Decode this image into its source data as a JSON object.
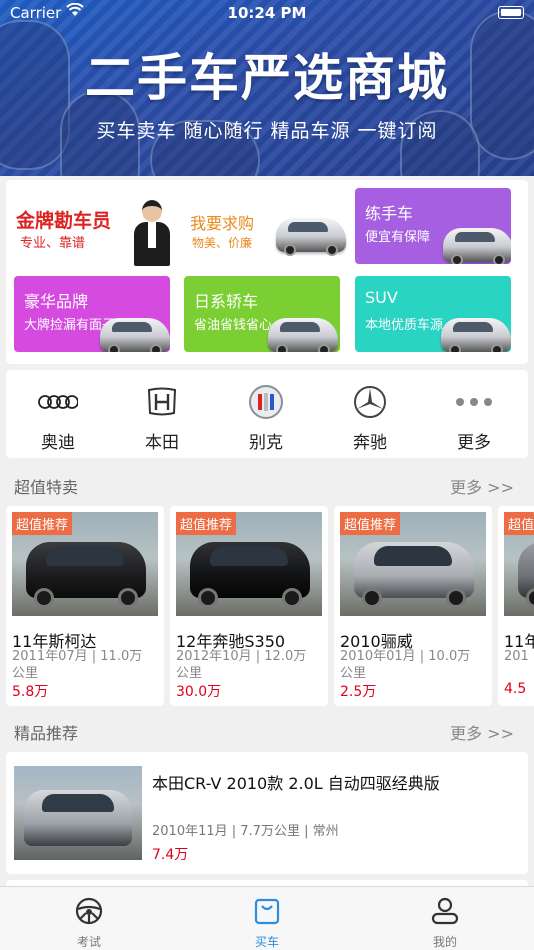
{
  "status_bar": {
    "carrier": "Carrier",
    "time": "10:24 PM"
  },
  "banner": {
    "title": "二手车严选商城",
    "subtitle": "买车卖车 随心随行 精品车源 一键订阅"
  },
  "promo": {
    "agent": {
      "title": "金牌勘车员",
      "subtitle": "专业、靠谱"
    },
    "buy": {
      "title": "我要求购",
      "subtitle": "物美、价廉"
    },
    "tiles": [
      {
        "title": "练手车",
        "subtitle": "便宜有保障",
        "color": "#a55fe0"
      },
      {
        "title": "豪华品牌",
        "subtitle": "大牌捡漏有面子",
        "color": "#d54be0"
      },
      {
        "title": "日系轿车",
        "subtitle": "省油省钱省心",
        "color": "#7ccf32"
      },
      {
        "title": "SUV",
        "subtitle": "本地优质车源",
        "color": "#2ad4c3"
      }
    ]
  },
  "brands": [
    {
      "label": "奥迪",
      "icon": "audi-logo-icon"
    },
    {
      "label": "本田",
      "icon": "honda-logo-icon"
    },
    {
      "label": "别克",
      "icon": "buick-logo-icon"
    },
    {
      "label": "奔驰",
      "icon": "mercedes-logo-icon"
    },
    {
      "label": "更多",
      "icon": "more-dots-icon"
    }
  ],
  "deals": {
    "title": "超值特卖",
    "more": "更多 >>",
    "items": [
      {
        "tag": "超值推荐",
        "name": "11年斯柯达",
        "meta": "2011年07月 | 11.0万公里",
        "price": "5.8万",
        "color": "#1c1c1e"
      },
      {
        "tag": "超值推荐",
        "name": "12年奔驰S350",
        "meta": "2012年10月 | 12.0万公里",
        "price": "30.0万",
        "color": "#111214"
      },
      {
        "tag": "超值推荐",
        "name": "2010骊威",
        "meta": "2010年01月 | 10.0万公里",
        "price": "2.5万",
        "color": "#a9adb2"
      },
      {
        "tag": "超值推荐",
        "name": "11年",
        "meta": "201",
        "price": "4.5",
        "color": "#6f7378"
      }
    ]
  },
  "featured": {
    "title": "精品推荐",
    "more": "更多 >>",
    "item": {
      "title": "本田CR-V 2010款 2.0L 自动四驱经典版",
      "meta": "2010年11月 | 7.7万公里 | 常州",
      "price": "7.4万"
    }
  },
  "tabs": [
    {
      "label": "考试",
      "icon": "steering-wheel-icon"
    },
    {
      "label": "买车",
      "icon": "shopping-bag-icon"
    },
    {
      "label": "我的",
      "icon": "user-profile-icon"
    }
  ],
  "colors": {
    "accent": "#2d8be0",
    "price": "#e0001b",
    "tag": "#ec6d45"
  }
}
